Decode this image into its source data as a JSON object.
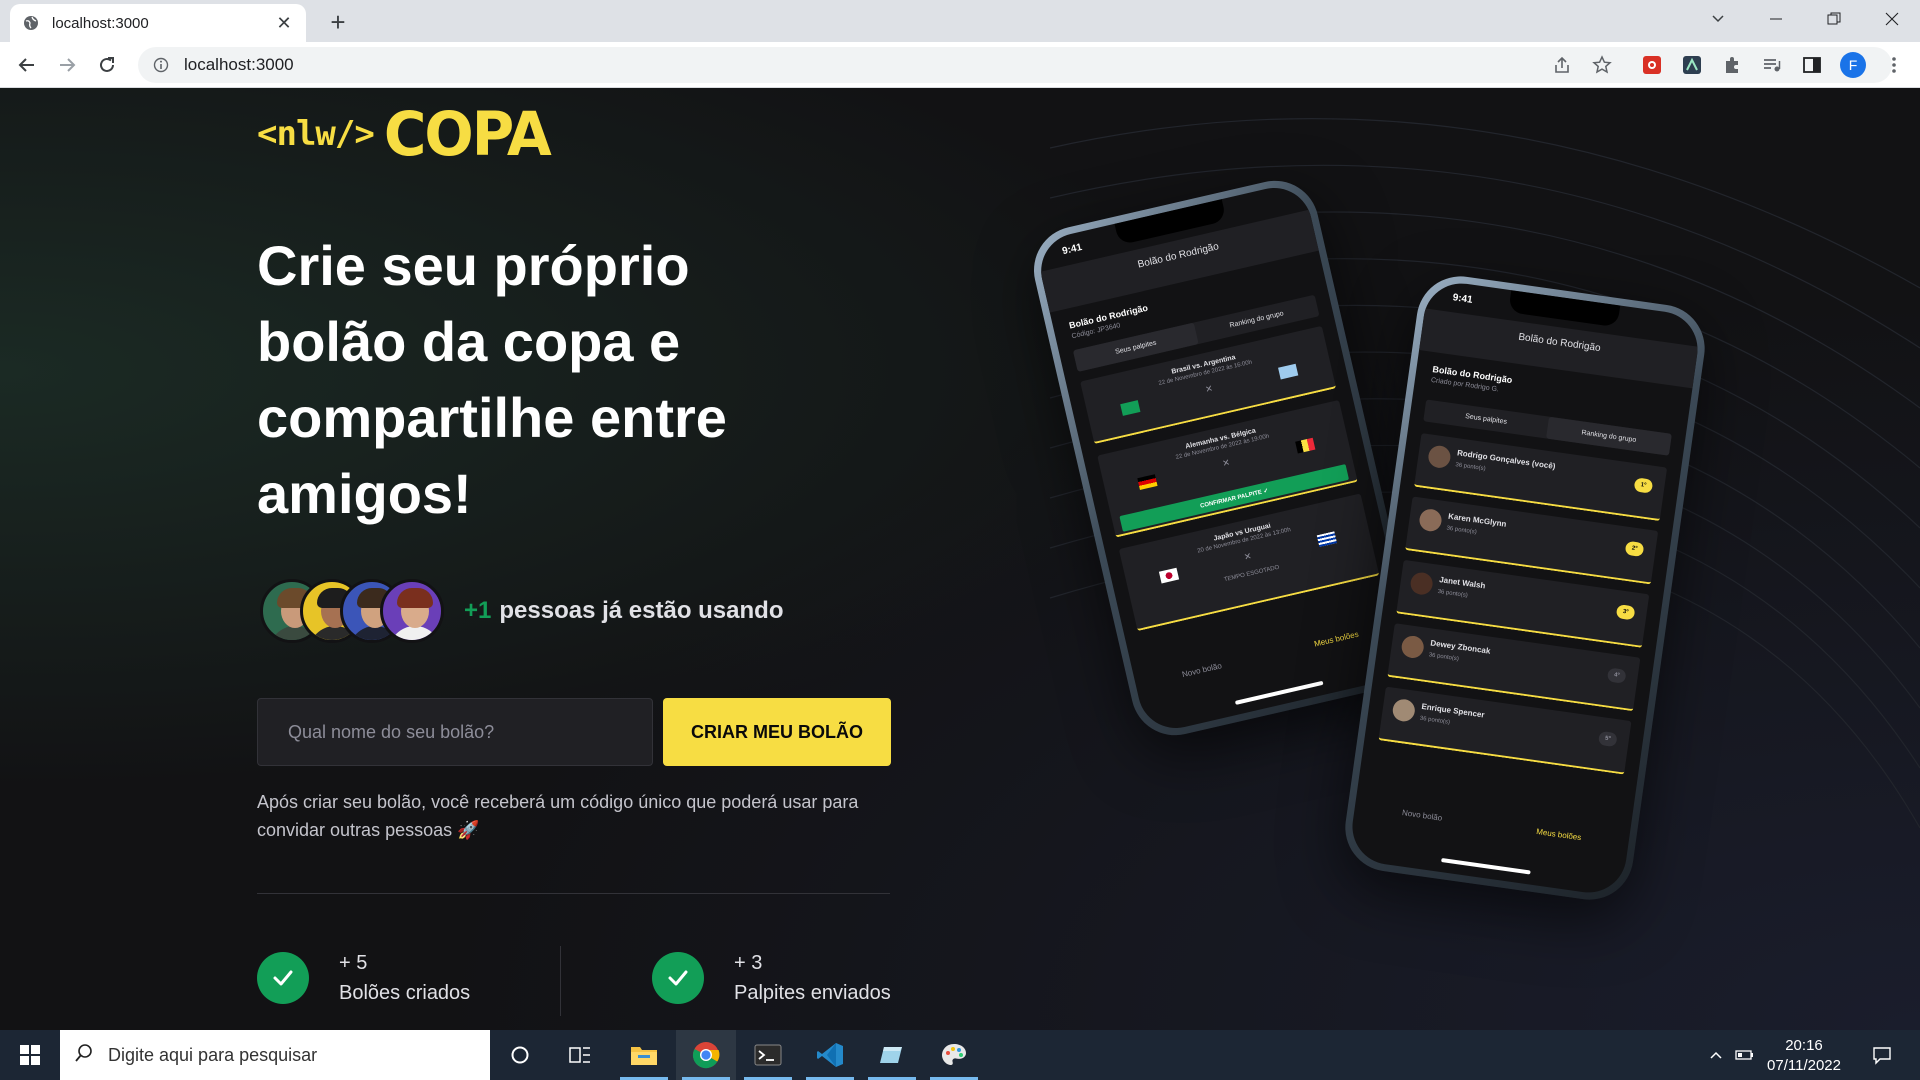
{
  "browser": {
    "tab_title": "localhost:3000",
    "new_tab_label": "+",
    "url": "localhost:3000",
    "profile_initial": "F"
  },
  "page": {
    "logo_prefix": "<nlw/>",
    "logo_main": "COPA",
    "headline": "Crie seu próprio bolão da copa e compartilhe entre amigos!",
    "users_count": "+1",
    "users_text": "pessoas já estão usando",
    "input_placeholder": "Qual nome do seu bolão?",
    "create_button": "Criar meu bolão",
    "helper_text": "Após criar seu bolão, você receberá um código único que poderá usar para convidar outras pessoas 🚀",
    "stats": [
      {
        "value": "+ 5",
        "label": "Bolões criados"
      },
      {
        "value": "+ 3",
        "label": "Palpites enviados"
      }
    ]
  },
  "phone_back": {
    "time": "9:41",
    "title": "Bolão do Rodrigão",
    "pool_name": "Bolão do Rodrigão",
    "pool_code": "Código: JP3640",
    "tabs": [
      "Seus palpites",
      "Ranking do grupo"
    ],
    "games": [
      {
        "title": "Brasil vs. Argentina",
        "date": "22 de Novembro de 2022 às 16:00h"
      },
      {
        "title": "Alemanha vs. Bélgica",
        "date": "22 de Novembro de 2022 às 19:00h"
      },
      {
        "title": "Japão vs Uruguai",
        "date": "20 de Novembro de 2022 às 13:00h"
      }
    ],
    "confirm_label": "CONFIRMAR PALPITE ✓",
    "expired_label": "TEMPO ESGOTADO",
    "nav": [
      "Novo bolão",
      "Meus bolões"
    ]
  },
  "phone_front": {
    "time": "9:41",
    "title": "Bolão do Rodrigão",
    "pool_name": "Bolão do Rodrigão",
    "pool_sub": "Criado por Rodrigo G.",
    "tabs": [
      "Seus palpites",
      "Ranking do grupo"
    ],
    "ranking": [
      {
        "name": "Rodrigo Gonçalves (você)",
        "points": "36 ponto(s)",
        "pos": "1º"
      },
      {
        "name": "Karen McGlynn",
        "points": "36 ponto(s)",
        "pos": "2º"
      },
      {
        "name": "Janet Walsh",
        "points": "36 ponto(s)",
        "pos": "3º"
      },
      {
        "name": "Dewey Zboncak",
        "points": "36 ponto(s)",
        "pos": "4º"
      },
      {
        "name": "Enrique Spencer",
        "points": "36 ponto(s)",
        "pos": "5º"
      }
    ],
    "nav": [
      "Novo bolão",
      "Meus bolões"
    ]
  },
  "taskbar": {
    "search_placeholder": "Digite aqui para pesquisar",
    "time": "20:16",
    "date": "07/11/2022"
  },
  "colors": {
    "brand_yellow": "#F7DD43",
    "brand_green": "#129E57",
    "background": "#121214"
  }
}
